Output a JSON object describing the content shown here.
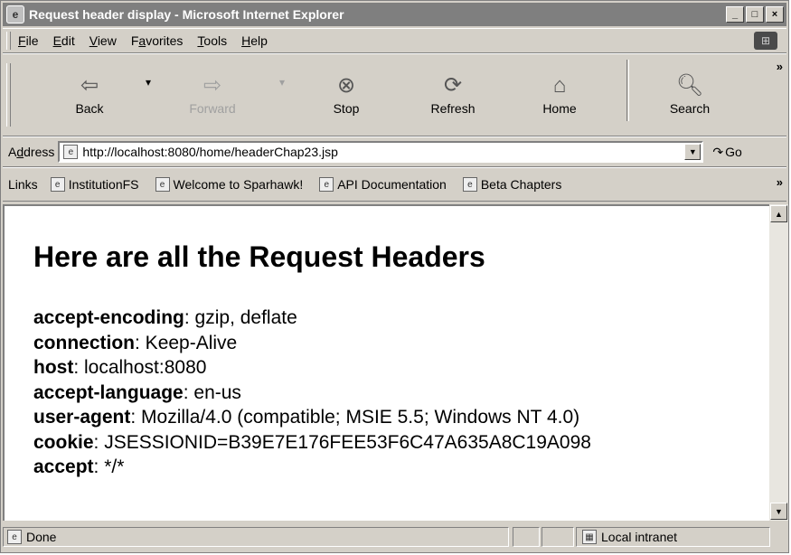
{
  "window": {
    "title": "Request header display - Microsoft Internet Explorer",
    "controls": {
      "minimize": "_",
      "maximize": "□",
      "close": "×"
    }
  },
  "menu": {
    "items": [
      {
        "accel": "F",
        "rest": "ile"
      },
      {
        "accel": "E",
        "rest": "dit"
      },
      {
        "accel": "V",
        "rest": "iew"
      },
      {
        "pre": "F",
        "accel": "a",
        "rest": "vorites"
      },
      {
        "accel": "T",
        "rest": "ools"
      },
      {
        "accel": "H",
        "rest": "elp"
      }
    ]
  },
  "toolbar": {
    "back": "Back",
    "forward": "Forward",
    "stop": "Stop",
    "refresh": "Refresh",
    "home": "Home",
    "search": "Search",
    "chevron": "»"
  },
  "address": {
    "label_pre": "A",
    "label_accel": "d",
    "label_rest": "dress",
    "url": "http://localhost:8080/home/headerChap23.jsp",
    "go": "Go"
  },
  "links": {
    "label": "Links",
    "items": [
      "InstitutionFS",
      "Welcome to Sparhawk!",
      "API Documentation",
      "Beta Chapters"
    ],
    "chevron": "»"
  },
  "page": {
    "heading": "Here are all the Request Headers",
    "headers": [
      {
        "name": "accept-encoding",
        "value": ": gzip, deflate"
      },
      {
        "name": "connection",
        "value": ": Keep-Alive"
      },
      {
        "name": "host",
        "value": ": localhost:8080"
      },
      {
        "name": "accept-language",
        "value": ": en-us"
      },
      {
        "name": "user-agent",
        "value": ": Mozilla/4.0 (compatible; MSIE 5.5; Windows NT 4.0)"
      },
      {
        "name": "cookie",
        "value": ": JSESSIONID=B39E7E176FEE53F6C47A635A8C19A098"
      },
      {
        "name": "accept",
        "value": ": */*"
      }
    ]
  },
  "status": {
    "text": "Done",
    "zone": "Local intranet"
  }
}
